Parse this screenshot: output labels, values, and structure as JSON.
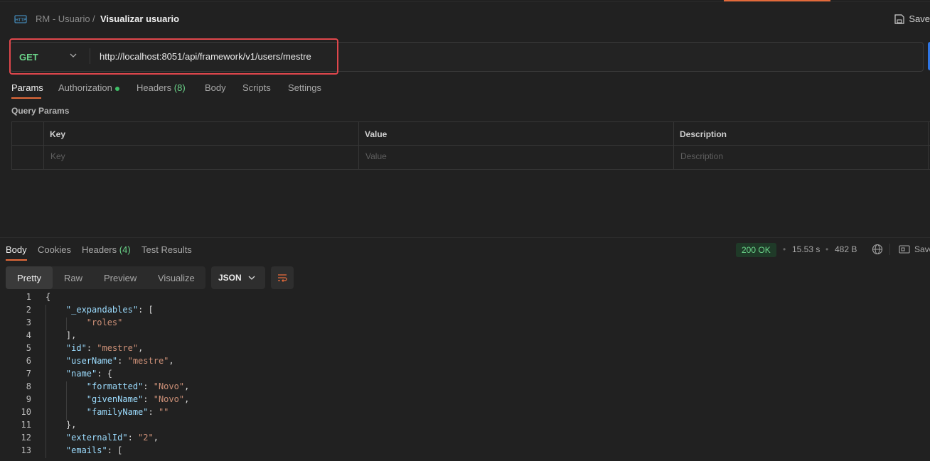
{
  "header": {
    "breadcrumb_parent": "RM - Usuario",
    "breadcrumb_sep": "/",
    "breadcrumb_current": "Visualizar usuario",
    "save_label": "Save"
  },
  "request": {
    "method": "GET",
    "url": "http://localhost:8051/api/framework/v1/users/mestre"
  },
  "request_tabs": {
    "params": "Params",
    "authorization": "Authorization",
    "headers": "Headers",
    "headers_count": "(8)",
    "body": "Body",
    "scripts": "Scripts",
    "settings": "Settings"
  },
  "query_params": {
    "title": "Query Params",
    "columns": [
      "Key",
      "Value",
      "Description"
    ],
    "placeholders": [
      "Key",
      "Value",
      "Description"
    ]
  },
  "response_tabs": {
    "body": "Body",
    "cookies": "Cookies",
    "headers": "Headers",
    "headers_count": "(4)",
    "test_results": "Test Results"
  },
  "response_meta": {
    "status": "200 OK",
    "time": "15.53 s",
    "size": "482 B",
    "save_label": "Save"
  },
  "view_modes": {
    "pretty": "Pretty",
    "raw": "Raw",
    "preview": "Preview",
    "visualize": "Visualize",
    "format": "JSON"
  },
  "code_lines": [
    {
      "n": "1",
      "t": "{"
    },
    {
      "n": "2",
      "t": "    \"_expandables\": ["
    },
    {
      "n": "3",
      "t": "        \"roles\""
    },
    {
      "n": "4",
      "t": "    ],"
    },
    {
      "n": "5",
      "t": "    \"id\": \"mestre\","
    },
    {
      "n": "6",
      "t": "    \"userName\": \"mestre\","
    },
    {
      "n": "7",
      "t": "    \"name\": {"
    },
    {
      "n": "8",
      "t": "        \"formatted\": \"Novo\","
    },
    {
      "n": "9",
      "t": "        \"givenName\": \"Novo\","
    },
    {
      "n": "10",
      "t": "        \"familyName\": \"\""
    },
    {
      "n": "11",
      "t": "    },"
    },
    {
      "n": "12",
      "t": "    \"externalId\": \"2\","
    },
    {
      "n": "13",
      "t": "    \"emails\": ["
    }
  ],
  "colors": {
    "accent": "#e46a3a",
    "method_get": "#6bd58a",
    "highlight_box": "#e0474c",
    "json_key": "#9cdcfe",
    "json_string": "#ce9178"
  }
}
